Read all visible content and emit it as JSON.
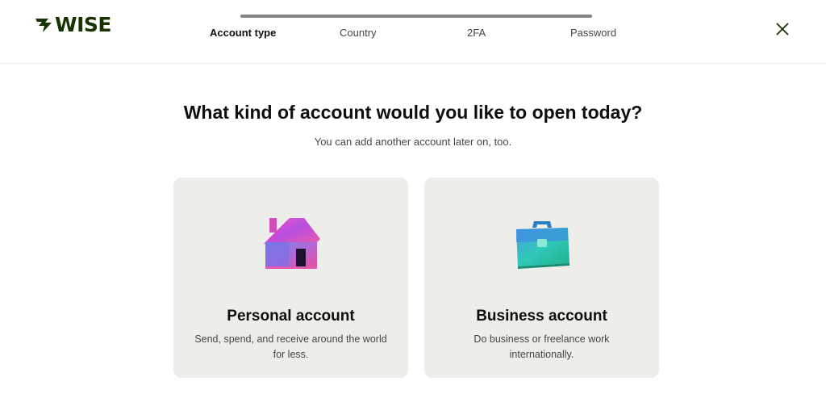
{
  "brand": {
    "logo_text": "WISE",
    "color": "#163300"
  },
  "progress": {
    "fraction_complete": 1.0,
    "steps": [
      {
        "label": "Account type",
        "active": true
      },
      {
        "label": "Country",
        "active": false
      },
      {
        "label": "2FA",
        "active": false
      },
      {
        "label": "Password",
        "active": false
      }
    ]
  },
  "header": {
    "close_icon": "close-icon"
  },
  "main": {
    "title": "What kind of account would you like to open today?",
    "subtitle": "You can add another account later on, too."
  },
  "cards": [
    {
      "title": "Personal account",
      "description": "Send, spend, and receive around the world for less.",
      "icon": "house-icon"
    },
    {
      "title": "Business account",
      "description": "Do business or freelance work internationally.",
      "icon": "briefcase-icon"
    }
  ],
  "colors": {
    "card_background": "#ededea",
    "text_primary": "#0e0f0c",
    "text_secondary": "#454745",
    "accent_green": "#163300"
  }
}
